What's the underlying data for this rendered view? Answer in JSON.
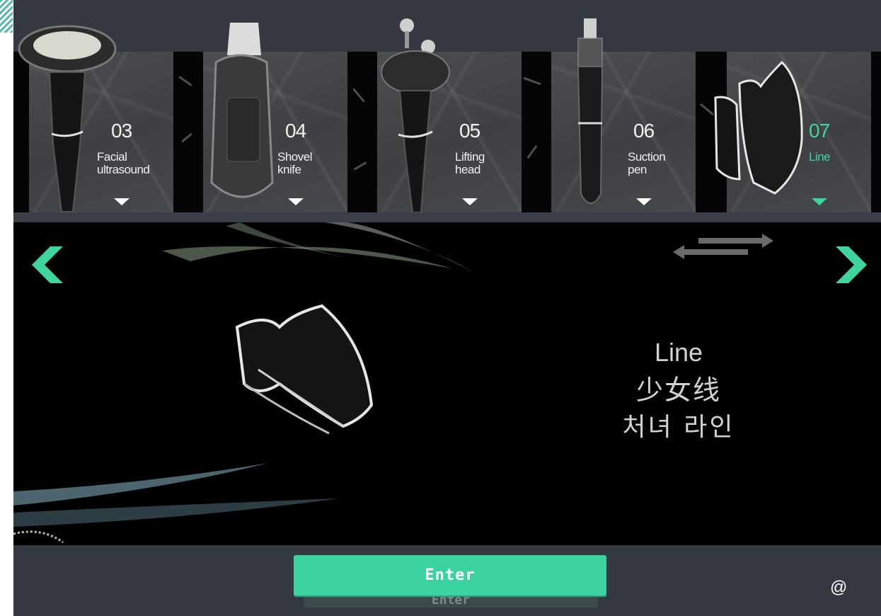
{
  "handles": [
    {
      "number": "03",
      "label_line1": "Facial",
      "label_line2": "ultrasound",
      "icon": "facial-ultrasound-handle-icon"
    },
    {
      "number": "04",
      "label_line1": "Shovel",
      "label_line2": "knife",
      "icon": "shovel-knife-handle-icon"
    },
    {
      "number": "05",
      "label_line1": "Lifting",
      "label_line2": "head",
      "icon": "lifting-head-handle-icon"
    },
    {
      "number": "06",
      "label_line1": "Suction",
      "label_line2": "pen",
      "icon": "suction-pen-handle-icon"
    },
    {
      "number": "07",
      "label_line1": "Line",
      "label_line2": "",
      "icon": "line-handle-icon",
      "selected": true
    }
  ],
  "nav": {
    "prev_icon": "chevron-left-icon",
    "next_icon": "chevron-right-icon",
    "swap_icon": "double-arrow-icon"
  },
  "selected": {
    "name_en": "Line",
    "name_zh": "少女线",
    "name_ko": "처녀 라인"
  },
  "footer": {
    "enter_label": "Enter",
    "enter_reflection": "Enter",
    "at_symbol": "@"
  },
  "colors": {
    "accent": "#3ad29e",
    "background": "#343841",
    "display": "#000000"
  }
}
